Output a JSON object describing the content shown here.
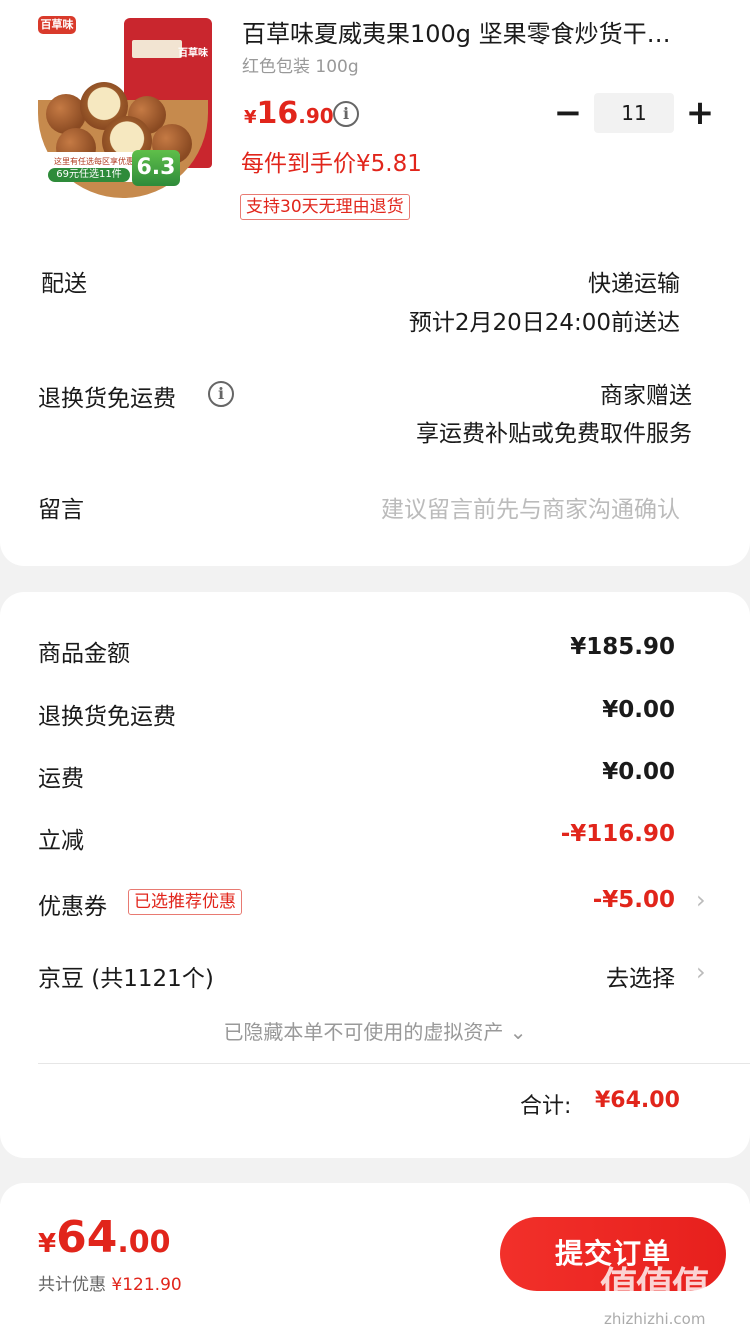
{
  "product": {
    "title": "百草味夏威夷果100g 坚果零食炒货干…",
    "variant": "红色包装 100g",
    "price_symbol": "¥",
    "price_int": "16",
    "price_dec": ".90",
    "unit_price": "每件到手价¥5.81",
    "return_policy": "支持30天无理由退货",
    "quantity": "11",
    "minus_label": "−",
    "plus_label": "+",
    "image": {
      "brand": "百草味",
      "promo_small": "这里有任选每区享优惠",
      "promo_green": "69元任选11件",
      "promo_price": "6.3"
    }
  },
  "delivery": {
    "label": "配送",
    "method": "快递运输",
    "eta": "预计2月20日24:00前送达"
  },
  "return_shipping": {
    "label": "退换货免运费",
    "value": "商家赠送",
    "desc": "享运费补贴或免费取件服务"
  },
  "message": {
    "label": "留言",
    "placeholder": "建议留言前先与商家沟通确认"
  },
  "summary": {
    "items": [
      {
        "label": "商品金额",
        "value": "¥185.90"
      },
      {
        "label": "退换货免运费",
        "value": "¥0.00"
      },
      {
        "label": "运费",
        "value": "¥0.00"
      },
      {
        "label": "立减",
        "value": "-¥116.90"
      },
      {
        "label": "优惠券",
        "value": "-¥5.00",
        "tag": "已选推荐优惠"
      },
      {
        "label": "京豆 (共1121个)",
        "value": "去选择"
      }
    ],
    "hidden_note": "已隐藏本单不可使用的虚拟资产 ⌄",
    "total_label": "合计:",
    "total_value": "¥64.00"
  },
  "footer": {
    "price_symbol": "¥",
    "price_int": "64",
    "price_dec": ".00",
    "saved_label": "共计优惠",
    "saved_value": "¥121.90",
    "submit_label": "提交订单",
    "watermark": "值值值",
    "watermark_url": "zhizhizhi.com"
  },
  "colors": {
    "accent": "#e1251b",
    "background": "#f2f2f2"
  }
}
